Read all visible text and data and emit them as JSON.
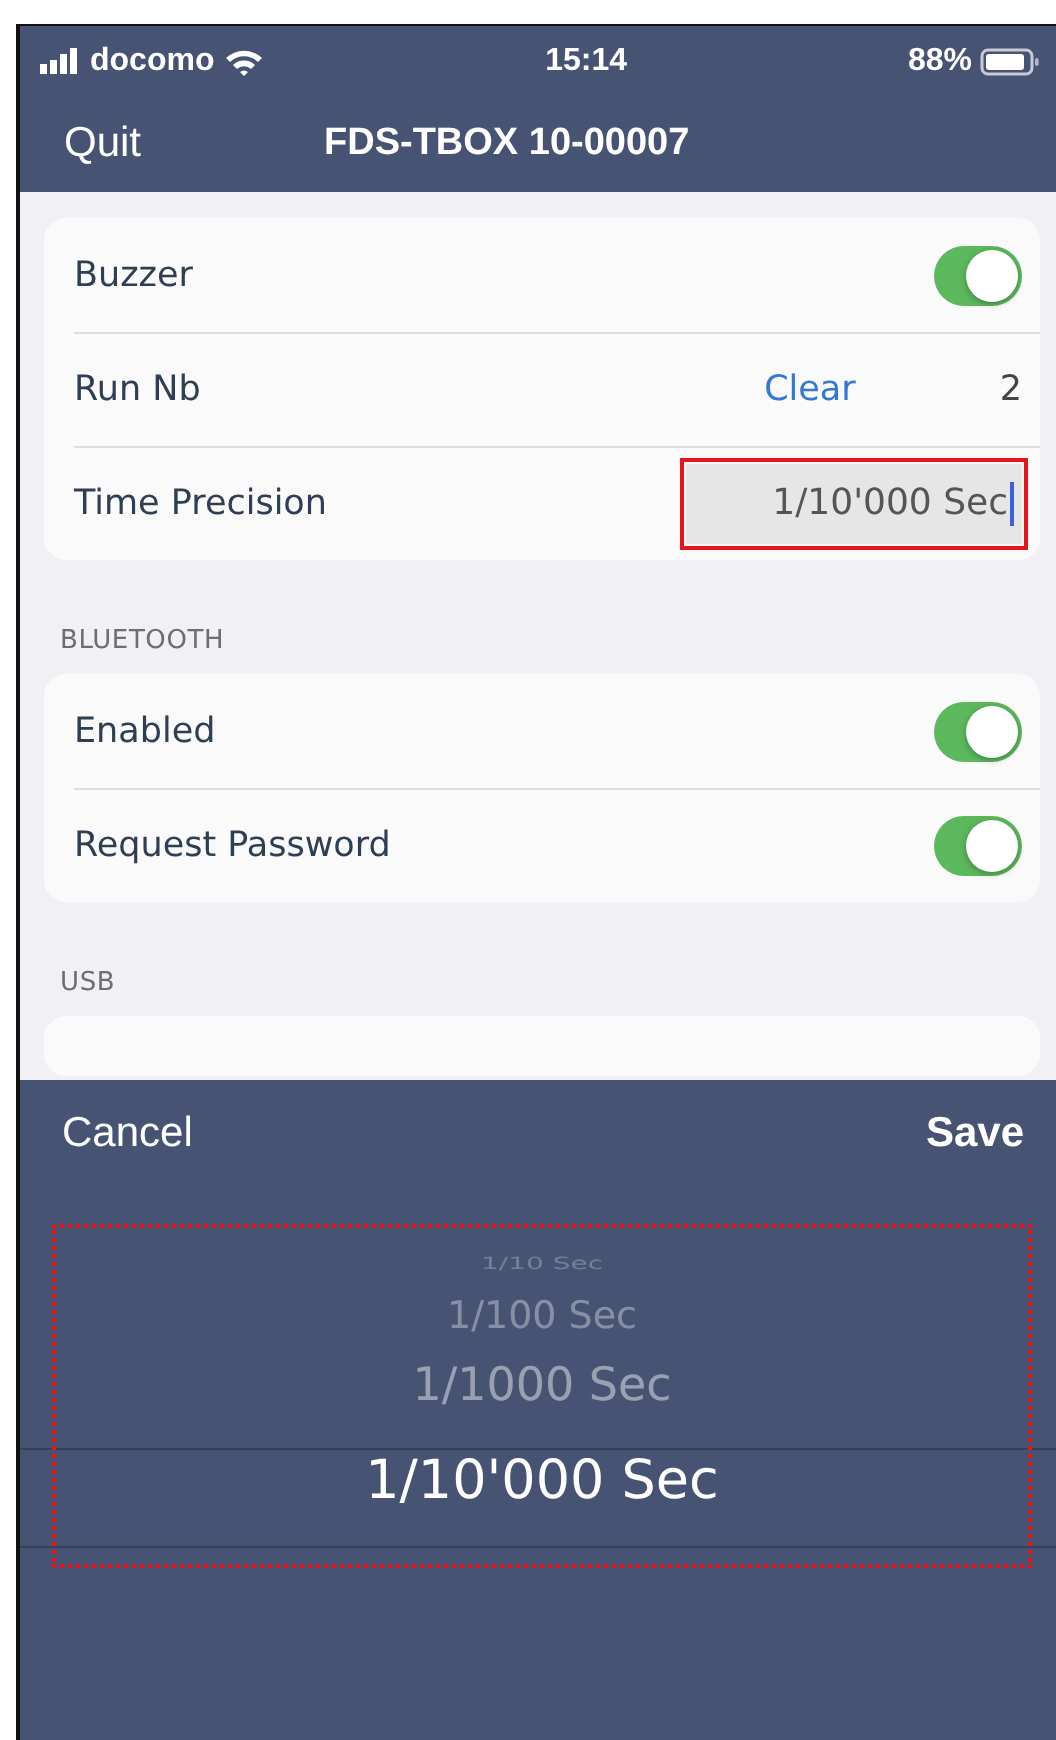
{
  "status_bar": {
    "carrier": "docomo",
    "time": "15:14",
    "battery": "88%"
  },
  "nav_bar": {
    "left_button": "Quit",
    "title": "FDS-TBOX 10-00007"
  },
  "sections": [
    {
      "rows": [
        {
          "kind": "toggle",
          "label": "Buzzer",
          "on": true
        },
        {
          "kind": "action",
          "label": "Run Nb",
          "action": "Clear",
          "value": "2"
        },
        {
          "kind": "field",
          "label": "Time Precision",
          "value": "1/10'000 Sec",
          "focused": true,
          "highlighted": true
        }
      ]
    },
    {
      "header": "BLUETOOTH",
      "rows": [
        {
          "kind": "toggle",
          "label": "Enabled",
          "on": true
        },
        {
          "kind": "toggle",
          "label": "Request Password",
          "on": true
        }
      ]
    },
    {
      "header": "USB"
    }
  ],
  "picker": {
    "cancel": "Cancel",
    "save": "Save",
    "highlighted": true,
    "options": [
      {
        "label": "1/10 Sec",
        "selected": false
      },
      {
        "label": "1/100 Sec",
        "selected": false
      },
      {
        "label": "1/1000 Sec",
        "selected": false
      },
      {
        "label": "1/10'000 Sec",
        "selected": true
      }
    ]
  }
}
